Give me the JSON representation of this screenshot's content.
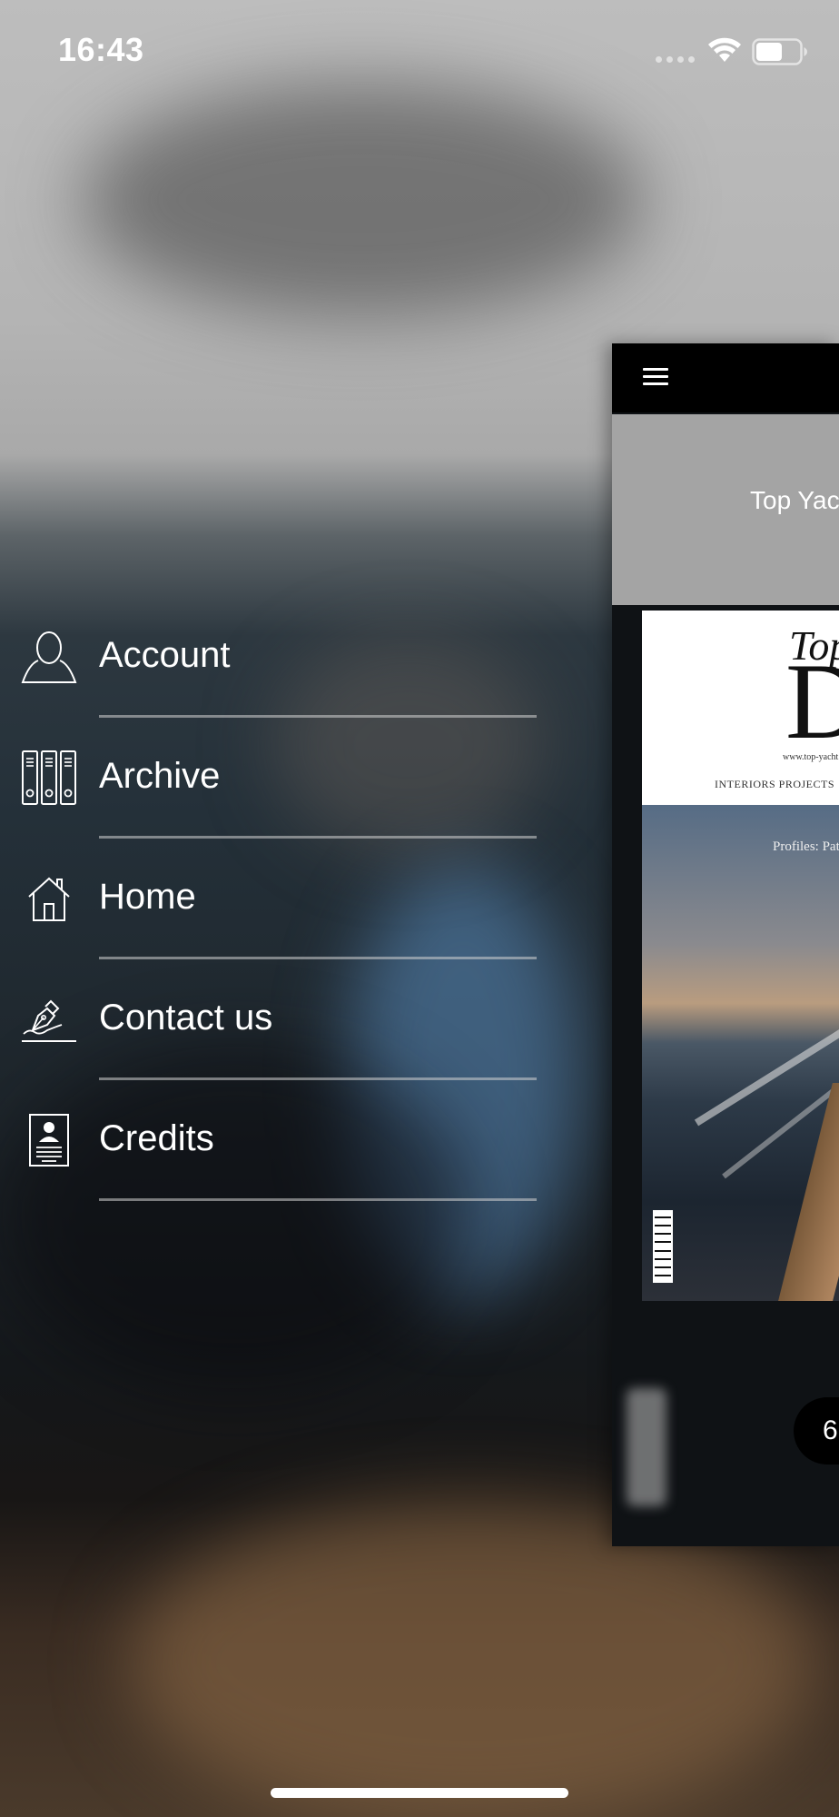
{
  "status_bar": {
    "time": "16:43",
    "wifi_icon": "wifi-icon",
    "battery_icon": "battery-icon",
    "battery_level": 0.6
  },
  "menu": {
    "items": [
      {
        "label": "Account",
        "icon": "person-icon"
      },
      {
        "label": "Archive",
        "icon": "binders-icon"
      },
      {
        "label": "Home",
        "icon": "house-icon"
      },
      {
        "label": "Contact us",
        "icon": "pen-signature-icon"
      },
      {
        "label": "Credits",
        "icon": "document-profile-icon"
      }
    ]
  },
  "preview": {
    "menu_icon": "hamburger-icon",
    "title": "Top Yac",
    "cover": {
      "masthead_top": "Top",
      "masthead_letter": "D",
      "url": "www.top-yacht",
      "sections": "INTERIORS  PROJECTS",
      "headline": "Profiles: Pat"
    },
    "page_indicator": "6"
  },
  "colors": {
    "menu_text": "#ffffff",
    "divider": "#d2d2d2",
    "toolbar": "#000000",
    "header_band": "#a4a4a4"
  }
}
